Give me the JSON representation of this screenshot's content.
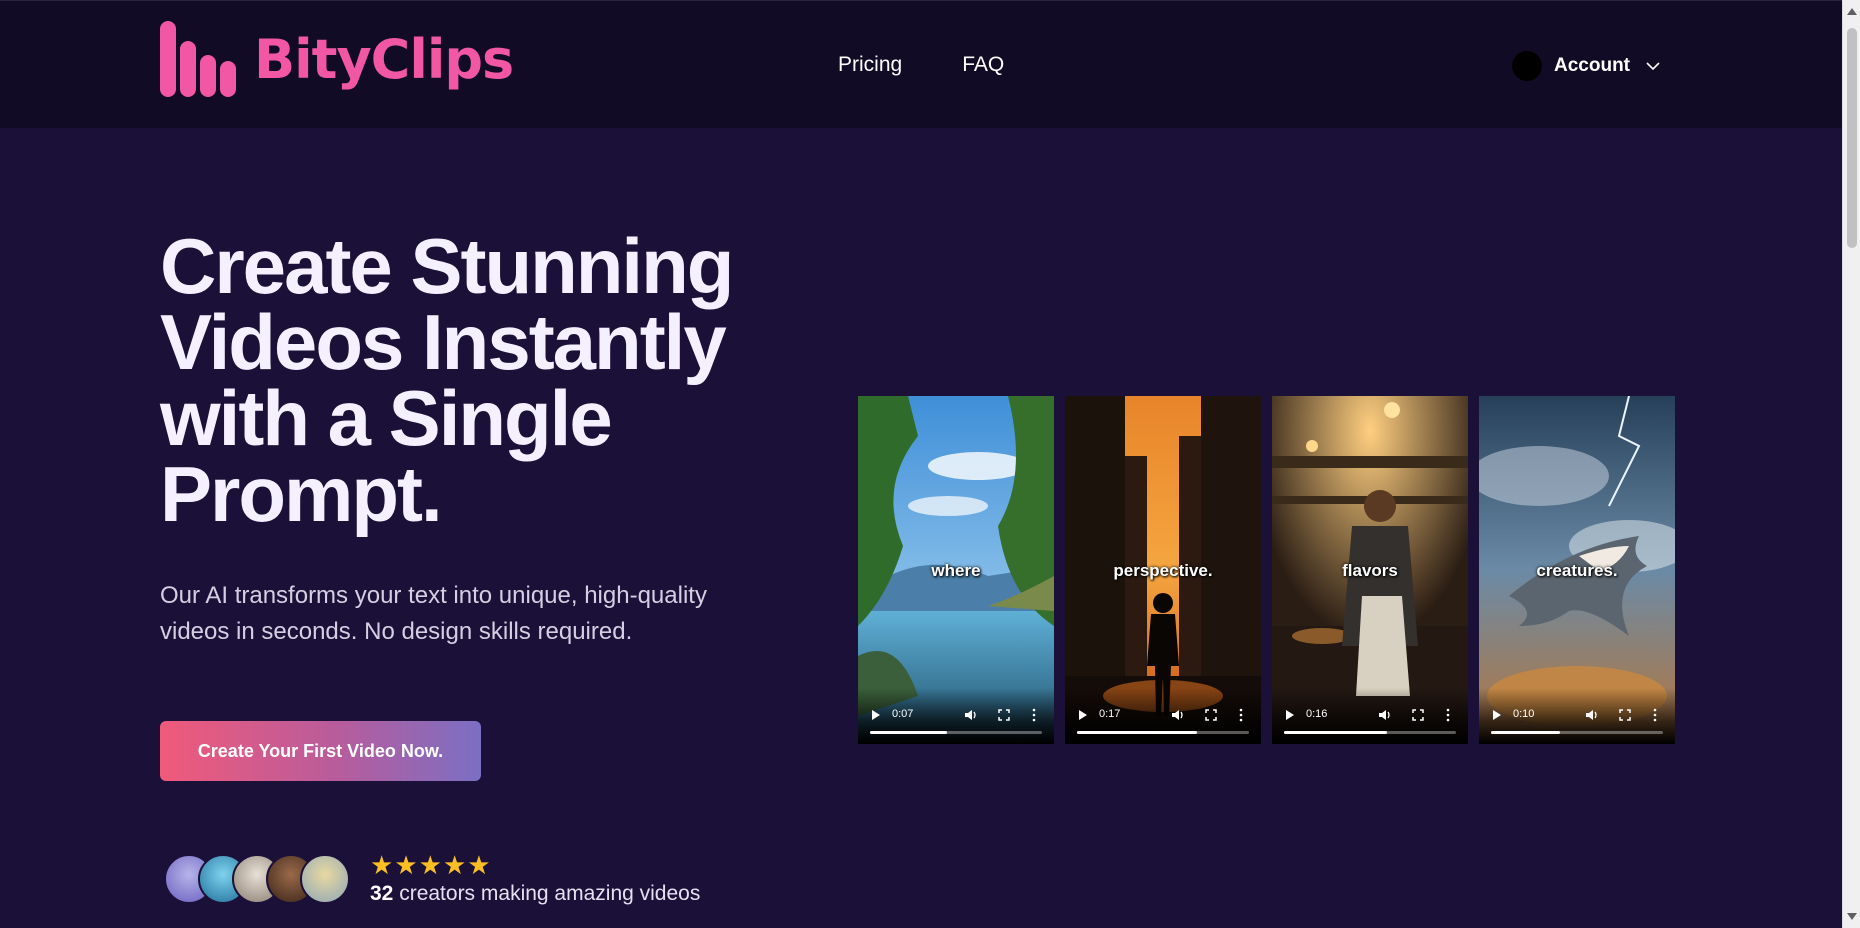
{
  "brand": {
    "name": "BityClips",
    "color": "#f257a6"
  },
  "nav": {
    "links": [
      {
        "label": "Pricing"
      },
      {
        "label": "FAQ"
      }
    ],
    "account_label": "Account"
  },
  "hero": {
    "headline": "Create Stunning Videos Instantly with a Single Prompt.",
    "subtitle": "Our AI transforms your text into unique, high-quality videos in seconds. No design skills required.",
    "cta_label": "Create Your First Video Now."
  },
  "videos": [
    {
      "caption": "where",
      "time": "0:07",
      "progress": 0.45
    },
    {
      "caption": "perspective.",
      "time": "0:17",
      "progress": 0.7
    },
    {
      "caption": "flavors",
      "time": "0:16",
      "progress": 0.6
    },
    {
      "caption": "creatures.",
      "time": "0:10",
      "progress": 0.4
    }
  ],
  "social_proof": {
    "rating": 5,
    "count": "32",
    "text": "creators making amazing videos"
  },
  "colors": {
    "background": "#1b1038",
    "navbar": "#120b26",
    "star": "#fbbf24",
    "cta_gradient_start": "#f15a7a",
    "cta_gradient_end": "#7b6fc4"
  }
}
